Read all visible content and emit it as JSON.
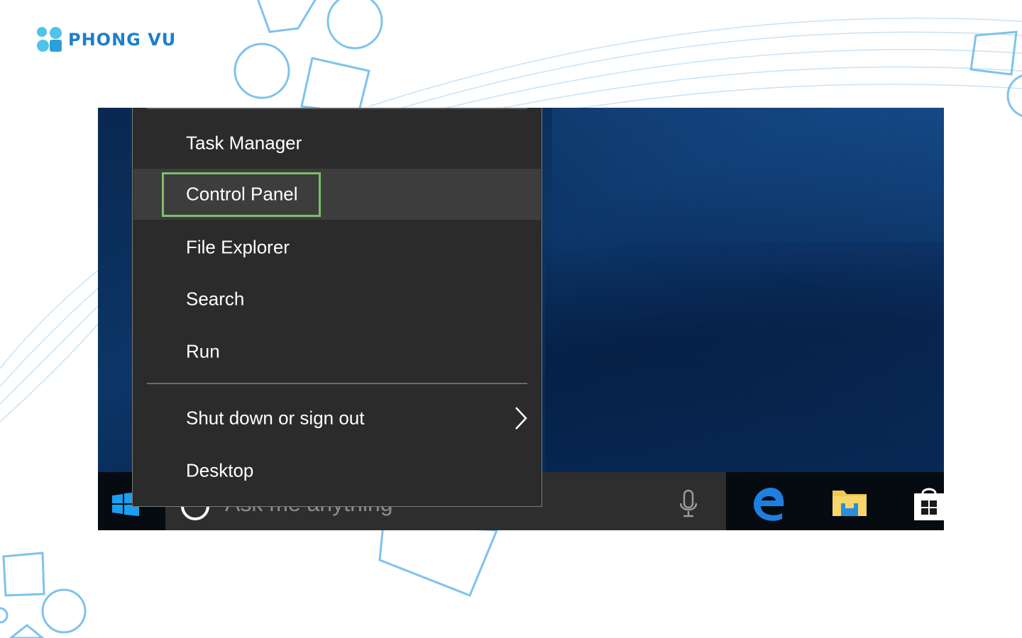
{
  "brand": {
    "name": "PHONG VU"
  },
  "colors": {
    "accent_highlight": "#7cc06a",
    "menu_bg": "#2b2b2b",
    "taskbar_bg": "#060b12",
    "brand_blue": "#1d7fc9"
  },
  "context_menu": {
    "items": [
      {
        "label": "Task Manager"
      },
      {
        "label": "Control Panel",
        "highlighted": true
      },
      {
        "label": "File Explorer"
      },
      {
        "label": "Search"
      },
      {
        "label": "Run"
      },
      {
        "label": "Shut down or sign out",
        "submenu": true
      },
      {
        "label": "Desktop"
      }
    ]
  },
  "taskbar": {
    "search_placeholder": "Ask me anything",
    "icons": [
      "windows-start-icon",
      "cortana-icon",
      "microphone-icon",
      "edge-icon",
      "file-explorer-icon",
      "store-icon"
    ]
  }
}
